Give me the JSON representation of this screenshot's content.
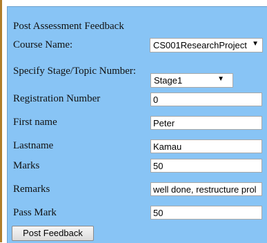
{
  "form": {
    "title": "Post Assessment Feedback",
    "course": {
      "label": "Course Name:",
      "value": "CS001ResearchProject"
    },
    "stage": {
      "label": "Specify Stage/Topic Number:",
      "value": "Stage1"
    },
    "registration": {
      "label": "Registration Number",
      "value": "0"
    },
    "first_name": {
      "label": "First name",
      "value": "Peter"
    },
    "last_name": {
      "label": "Lastname",
      "value": "Kamau"
    },
    "marks": {
      "label": "Marks",
      "value": "50"
    },
    "remarks": {
      "label": "Remarks",
      "value": "well done, restructure prol"
    },
    "pass_mark": {
      "label": "Pass Mark",
      "value": "50"
    },
    "submit_label": "Post Feedback"
  },
  "icons": {
    "dropdown": "chevron-down-icon"
  },
  "colors": {
    "panel_bg": "#88c4f5",
    "left_strip": "#b07d2a"
  }
}
